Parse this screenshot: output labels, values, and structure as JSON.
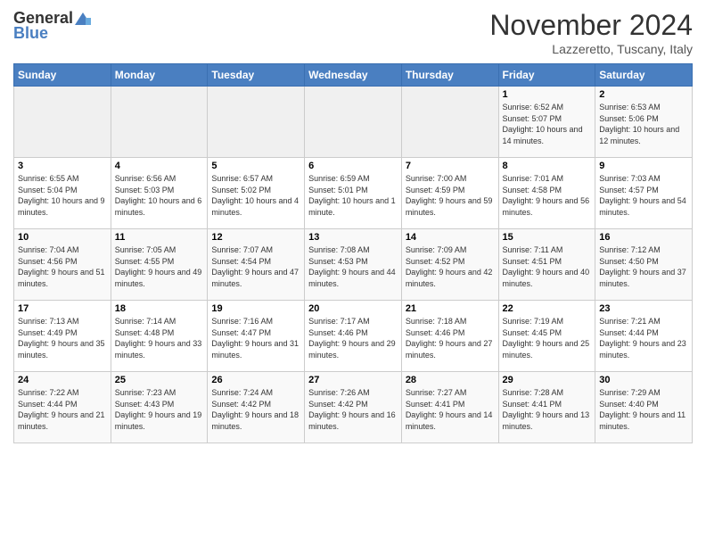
{
  "header": {
    "logo_general": "General",
    "logo_blue": "Blue",
    "month_title": "November 2024",
    "location": "Lazzeretto, Tuscany, Italy"
  },
  "columns": [
    "Sunday",
    "Monday",
    "Tuesday",
    "Wednesday",
    "Thursday",
    "Friday",
    "Saturday"
  ],
  "weeks": [
    {
      "days": [
        {
          "number": "",
          "info": ""
        },
        {
          "number": "",
          "info": ""
        },
        {
          "number": "",
          "info": ""
        },
        {
          "number": "",
          "info": ""
        },
        {
          "number": "",
          "info": ""
        },
        {
          "number": "1",
          "info": "Sunrise: 6:52 AM\nSunset: 5:07 PM\nDaylight: 10 hours and 14 minutes."
        },
        {
          "number": "2",
          "info": "Sunrise: 6:53 AM\nSunset: 5:06 PM\nDaylight: 10 hours and 12 minutes."
        }
      ]
    },
    {
      "days": [
        {
          "number": "3",
          "info": "Sunrise: 6:55 AM\nSunset: 5:04 PM\nDaylight: 10 hours and 9 minutes."
        },
        {
          "number": "4",
          "info": "Sunrise: 6:56 AM\nSunset: 5:03 PM\nDaylight: 10 hours and 6 minutes."
        },
        {
          "number": "5",
          "info": "Sunrise: 6:57 AM\nSunset: 5:02 PM\nDaylight: 10 hours and 4 minutes."
        },
        {
          "number": "6",
          "info": "Sunrise: 6:59 AM\nSunset: 5:01 PM\nDaylight: 10 hours and 1 minute."
        },
        {
          "number": "7",
          "info": "Sunrise: 7:00 AM\nSunset: 4:59 PM\nDaylight: 9 hours and 59 minutes."
        },
        {
          "number": "8",
          "info": "Sunrise: 7:01 AM\nSunset: 4:58 PM\nDaylight: 9 hours and 56 minutes."
        },
        {
          "number": "9",
          "info": "Sunrise: 7:03 AM\nSunset: 4:57 PM\nDaylight: 9 hours and 54 minutes."
        }
      ]
    },
    {
      "days": [
        {
          "number": "10",
          "info": "Sunrise: 7:04 AM\nSunset: 4:56 PM\nDaylight: 9 hours and 51 minutes."
        },
        {
          "number": "11",
          "info": "Sunrise: 7:05 AM\nSunset: 4:55 PM\nDaylight: 9 hours and 49 minutes."
        },
        {
          "number": "12",
          "info": "Sunrise: 7:07 AM\nSunset: 4:54 PM\nDaylight: 9 hours and 47 minutes."
        },
        {
          "number": "13",
          "info": "Sunrise: 7:08 AM\nSunset: 4:53 PM\nDaylight: 9 hours and 44 minutes."
        },
        {
          "number": "14",
          "info": "Sunrise: 7:09 AM\nSunset: 4:52 PM\nDaylight: 9 hours and 42 minutes."
        },
        {
          "number": "15",
          "info": "Sunrise: 7:11 AM\nSunset: 4:51 PM\nDaylight: 9 hours and 40 minutes."
        },
        {
          "number": "16",
          "info": "Sunrise: 7:12 AM\nSunset: 4:50 PM\nDaylight: 9 hours and 37 minutes."
        }
      ]
    },
    {
      "days": [
        {
          "number": "17",
          "info": "Sunrise: 7:13 AM\nSunset: 4:49 PM\nDaylight: 9 hours and 35 minutes."
        },
        {
          "number": "18",
          "info": "Sunrise: 7:14 AM\nSunset: 4:48 PM\nDaylight: 9 hours and 33 minutes."
        },
        {
          "number": "19",
          "info": "Sunrise: 7:16 AM\nSunset: 4:47 PM\nDaylight: 9 hours and 31 minutes."
        },
        {
          "number": "20",
          "info": "Sunrise: 7:17 AM\nSunset: 4:46 PM\nDaylight: 9 hours and 29 minutes."
        },
        {
          "number": "21",
          "info": "Sunrise: 7:18 AM\nSunset: 4:46 PM\nDaylight: 9 hours and 27 minutes."
        },
        {
          "number": "22",
          "info": "Sunrise: 7:19 AM\nSunset: 4:45 PM\nDaylight: 9 hours and 25 minutes."
        },
        {
          "number": "23",
          "info": "Sunrise: 7:21 AM\nSunset: 4:44 PM\nDaylight: 9 hours and 23 minutes."
        }
      ]
    },
    {
      "days": [
        {
          "number": "24",
          "info": "Sunrise: 7:22 AM\nSunset: 4:44 PM\nDaylight: 9 hours and 21 minutes."
        },
        {
          "number": "25",
          "info": "Sunrise: 7:23 AM\nSunset: 4:43 PM\nDaylight: 9 hours and 19 minutes."
        },
        {
          "number": "26",
          "info": "Sunrise: 7:24 AM\nSunset: 4:42 PM\nDaylight: 9 hours and 18 minutes."
        },
        {
          "number": "27",
          "info": "Sunrise: 7:26 AM\nSunset: 4:42 PM\nDaylight: 9 hours and 16 minutes."
        },
        {
          "number": "28",
          "info": "Sunrise: 7:27 AM\nSunset: 4:41 PM\nDaylight: 9 hours and 14 minutes."
        },
        {
          "number": "29",
          "info": "Sunrise: 7:28 AM\nSunset: 4:41 PM\nDaylight: 9 hours and 13 minutes."
        },
        {
          "number": "30",
          "info": "Sunrise: 7:29 AM\nSunset: 4:40 PM\nDaylight: 9 hours and 11 minutes."
        }
      ]
    }
  ]
}
